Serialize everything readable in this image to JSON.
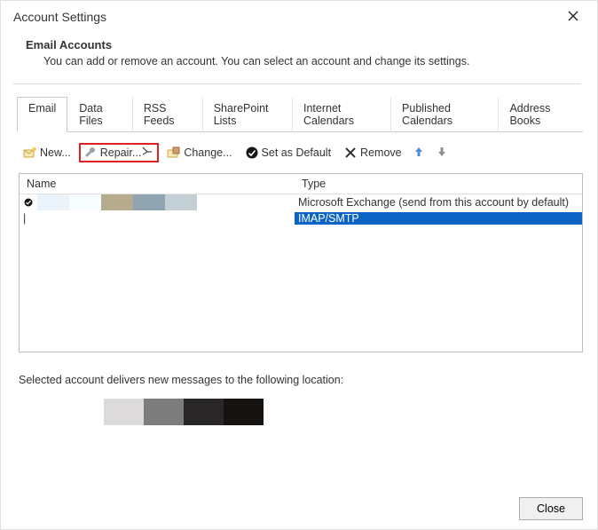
{
  "window": {
    "title": "Account Settings"
  },
  "header": {
    "section_title": "Email Accounts",
    "section_desc": "You can add or remove an account. You can select an account and change its settings."
  },
  "tabs": {
    "items": [
      {
        "label": "Email",
        "active": true
      },
      {
        "label": "Data Files"
      },
      {
        "label": "RSS Feeds"
      },
      {
        "label": "SharePoint Lists"
      },
      {
        "label": "Internet Calendars"
      },
      {
        "label": "Published Calendars"
      },
      {
        "label": "Address Books"
      }
    ]
  },
  "toolbar": {
    "new_label": "New...",
    "repair_label": "Repair...",
    "change_label": "Change...",
    "setdefault_label": "Set as Default",
    "remove_label": "Remove"
  },
  "list": {
    "col_name": "Name",
    "col_type": "Type",
    "rows": [
      {
        "default": true,
        "type": "Microsoft Exchange (send from this account by default)"
      },
      {
        "default": false,
        "type": "IMAP/SMTP",
        "selected": true
      }
    ]
  },
  "delivers": {
    "label": "Selected account delivers new messages to the following location:"
  },
  "footer": {
    "close_label": "Close"
  }
}
